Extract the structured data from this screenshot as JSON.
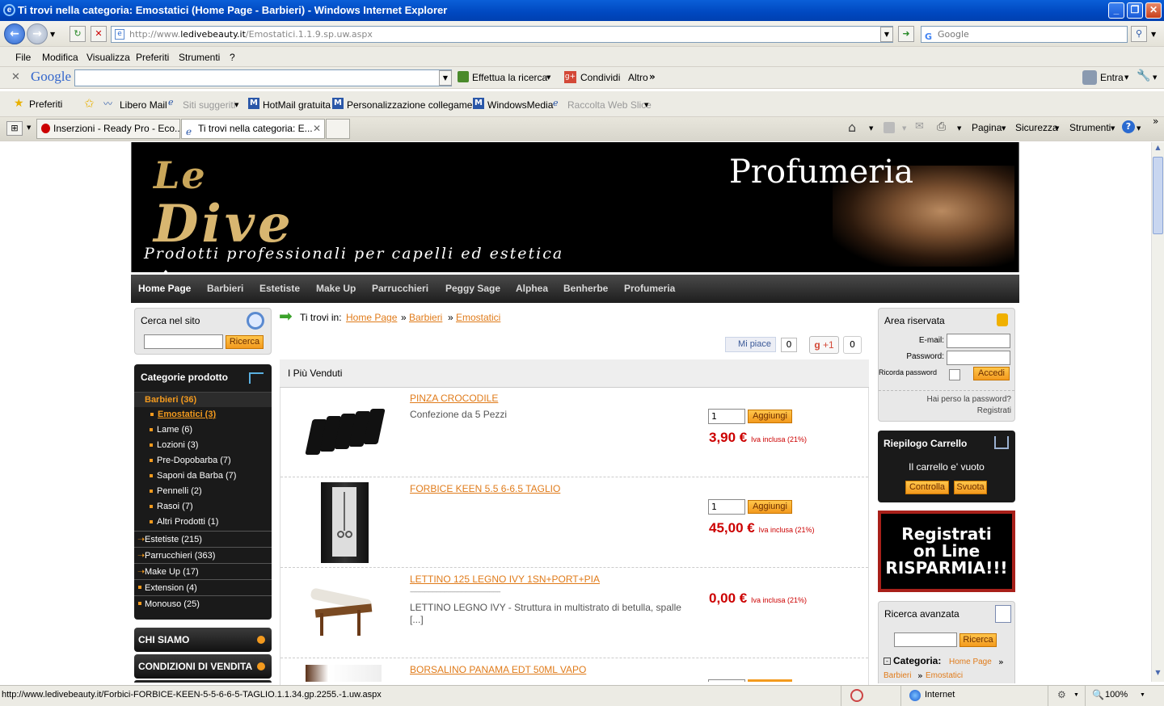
{
  "window": {
    "title": "Ti trovi nella categoria: Emostatici (Home Page - Barbieri) - Windows Internet Explorer"
  },
  "address": {
    "prefix": "http://www.",
    "domain": "ledivebeauty.it",
    "path": "/Emostatici.1.1.9.sp.uw.aspx",
    "search_placeholder": "Google"
  },
  "menu": [
    "File",
    "Modifica",
    "Visualizza",
    "Preferiti",
    "Strumenti",
    "?"
  ],
  "gbar": {
    "logo": "Google",
    "search_label": "Effettua la ricerca",
    "share_label": "Condividi",
    "more_label": "Altro",
    "login_label": "Entra"
  },
  "favorites": {
    "label": "Preferiti",
    "items": [
      "Libero Mail",
      "Siti suggeriti",
      "HotMail gratuita",
      "Personalizzazione collegamenti",
      "WindowsMedia",
      "Raccolta Web Slice"
    ]
  },
  "tabs": [
    "Inserzioni - Ready Pro - Eco...",
    "Ti trovi nella categoria: E..."
  ],
  "cmdbar": [
    "Pagina",
    "Sicurezza",
    "Strumenti"
  ],
  "site": {
    "logo_top": "Le",
    "logo_main": "Dive",
    "tagline": "Prodotti professionali per capelli ed estetica",
    "banner_right": "Profumeria",
    "nav": [
      "Home Page",
      "Barbieri",
      "Estetiste",
      "Make Up",
      "Parrucchieri",
      "Peggy Sage",
      "Alphea",
      "Benherbe",
      "Profumeria"
    ]
  },
  "search_box": {
    "title": "Cerca nel sito",
    "button": "Ricerca"
  },
  "categories": {
    "title": "Categorie prodotto",
    "open": "Barbieri (36)",
    "subs": [
      "Emostatici (3)",
      "Lame (6)",
      "Lozioni (3)",
      "Pre-Dopobarba (7)",
      "Saponi da Barba (7)",
      "Pennelli (2)",
      "Rasoi (7)",
      "Altri Prodotti (1)"
    ],
    "mains": [
      "Estetiste (215)",
      "Parrucchieri (363)",
      "Make Up (17)",
      "Extension (4)",
      "Monouso (25)"
    ]
  },
  "side_buttons": [
    "CHI SIAMO",
    "CONDIZIONI DI VENDITA"
  ],
  "breadcrumb": {
    "label": "Ti trovi in:",
    "items": [
      "Home Page",
      "Barbieri",
      "Emostatici"
    ],
    "sep": "»"
  },
  "social": {
    "like": "Mi piace",
    "like_count": "0",
    "plus": "+1",
    "plus_count": "0"
  },
  "products": {
    "heading": "I Più Venduti",
    "items": [
      {
        "name": "PINZA CROCODILE",
        "desc": "Confezione da 5 Pezzi",
        "qty": "1",
        "add": "Aggiungi",
        "price": "3,90 €",
        "iva": "Iva inclusa (21%)"
      },
      {
        "name": "FORBICE KEEN 5.5 6-6.5 TAGLIO",
        "desc": "",
        "qty": "1",
        "add": "Aggiungi",
        "price": "45,00 €",
        "iva": "Iva inclusa (21%)"
      },
      {
        "name": "LETTINO 125 LEGNO IVY 1SN+PORT+PIA",
        "desc1": "-------------------------------------------------------------------",
        "desc": "LETTINO LEGNO IVY - Struttura in multistrato di betulla, spalle",
        "desc2": "[...]",
        "price": "0,00 €",
        "iva": "Iva inclusa (21%)"
      },
      {
        "name": "BORSALINO PANAMA EDT 50ML VAPO"
      }
    ]
  },
  "login": {
    "title": "Area riservata",
    "email": "E-mail:",
    "password": "Password:",
    "remember": "Ricorda password",
    "submit": "Accedi",
    "forgot": "Hai perso la password?",
    "register": "Registrati"
  },
  "cart": {
    "title": "Riepilogo Carrello",
    "empty": "Il carrello e' vuoto",
    "check": "Controlla",
    "clear": "Svuota"
  },
  "promo": {
    "l1": "Registrati",
    "l2": "on Line",
    "l3": "RISPARMIA!!!"
  },
  "adv_search": {
    "title": "Ricerca avanzata",
    "button": "Ricerca",
    "cat_label": "Categoria:",
    "path1": "Home Page",
    "path2": "Barbieri",
    "path3": "Emostatici"
  },
  "status": {
    "url": "http://www.ledivebeauty.it/Forbici-FORBICE-KEEN-5-5-6-6-5-TAGLIO.1.1.34.gp.2255.-1.uw.aspx",
    "zone": "Internet",
    "zoom": "100%"
  }
}
